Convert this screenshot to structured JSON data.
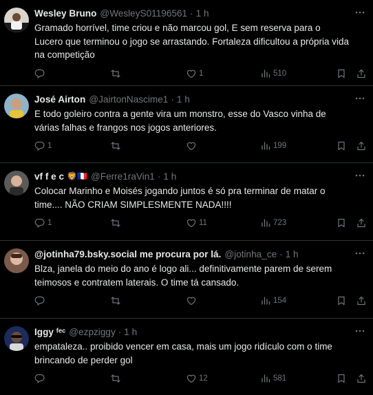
{
  "tweets": [
    {
      "display_name": "Wesley Bruno",
      "emoji": "",
      "handle": "@WesleyS01196561",
      "dot": "·",
      "time": "1 h",
      "text": "Gramado horrível, time criou e não marcou gol, E sem reserva para o Lucero que terminou o jogo se arrastando. Fortaleza dificultou a própria vida na competição",
      "replies": "",
      "retweets": "",
      "likes": "1",
      "views": "510"
    },
    {
      "display_name": "José Airton",
      "emoji": "",
      "handle": "@JairtonNascime1",
      "dot": "·",
      "time": "1 h",
      "text": "E todo goleiro contra a gente vira um monstro, esse do Vasco vinha de várias falhas e frangos nos jogos anteriores.",
      "replies": "1",
      "retweets": "",
      "likes": "",
      "views": "199"
    },
    {
      "display_name": "vf f e c",
      "emoji": "🦁🇫🇷",
      "handle": "@Ferre1raVin1",
      "dot": "·",
      "time": "1 h",
      "text": "Colocar Marinho e Moisés jogando juntos é só pra terminar de matar o time.... NÃO CRIAM SIMPLESMENTE NADA!!!!",
      "replies": "1",
      "retweets": "",
      "likes": "11",
      "views": "723"
    },
    {
      "display_name": "@jotinha79.bsky.social me procura por lá.",
      "emoji": "",
      "handle": "@jotinha_ce",
      "dot": "·",
      "time": "1 h",
      "text": "Blza, janela do meio do ano é logo ali... definitivamente parem de serem teimosos e contratem laterais. O time tá cansado.",
      "replies": "",
      "retweets": "",
      "likes": "",
      "views": "154"
    },
    {
      "display_name": "Iggy ᶠᵉᶜ",
      "emoji": "",
      "handle": "@ezpziggy",
      "dot": "·",
      "time": "1 h",
      "text": "empataleza.. proibido vencer em casa, mais um jogo ridículo com o time brincando de perder gol",
      "replies": "",
      "retweets": "",
      "likes": "12",
      "views": "581"
    }
  ],
  "icons": {
    "more": "more-horizontal-icon",
    "reply": "reply-icon",
    "retweet": "retweet-icon",
    "like": "heart-icon",
    "views": "views-bar-chart-icon",
    "bookmark": "bookmark-icon",
    "share": "share-icon"
  },
  "colors": {
    "background": "#000000",
    "text": "#e7e9ea",
    "muted": "#71767b",
    "divider": "#2f3336"
  }
}
